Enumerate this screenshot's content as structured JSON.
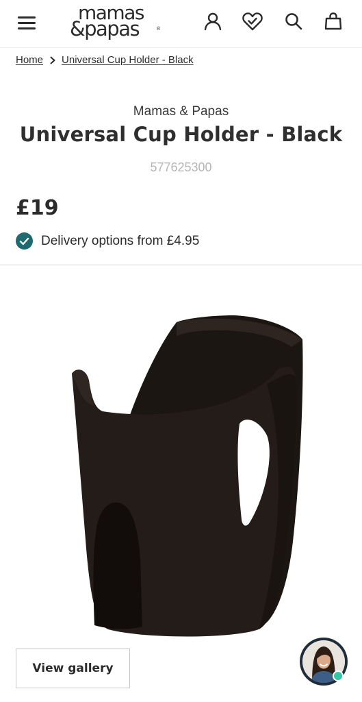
{
  "header": {
    "logo_line1": "mamas",
    "logo_line2": "&papas",
    "logo_reg": "®",
    "icons": [
      "menu-icon",
      "user-icon",
      "heart-icon",
      "search-icon",
      "bag-icon"
    ]
  },
  "breadcrumb": {
    "home": "Home",
    "current": "Universal Cup Holder - Black"
  },
  "product": {
    "brand": "Mamas & Papas",
    "title": "Universal Cup Holder - Black",
    "sku": "577625300",
    "price": "£19",
    "delivery": "Delivery options from £4.95",
    "image_alt_icon": "cup-holder-image"
  },
  "gallery": {
    "button_label": "View gallery"
  },
  "chat": {
    "icon": "chat-agent-avatar"
  },
  "colors": {
    "text": "#2b2b2b",
    "sku": "#b5b5b5",
    "check": "#1e6a6f",
    "product": "#231c18",
    "chat_status": "#32c7a7"
  }
}
